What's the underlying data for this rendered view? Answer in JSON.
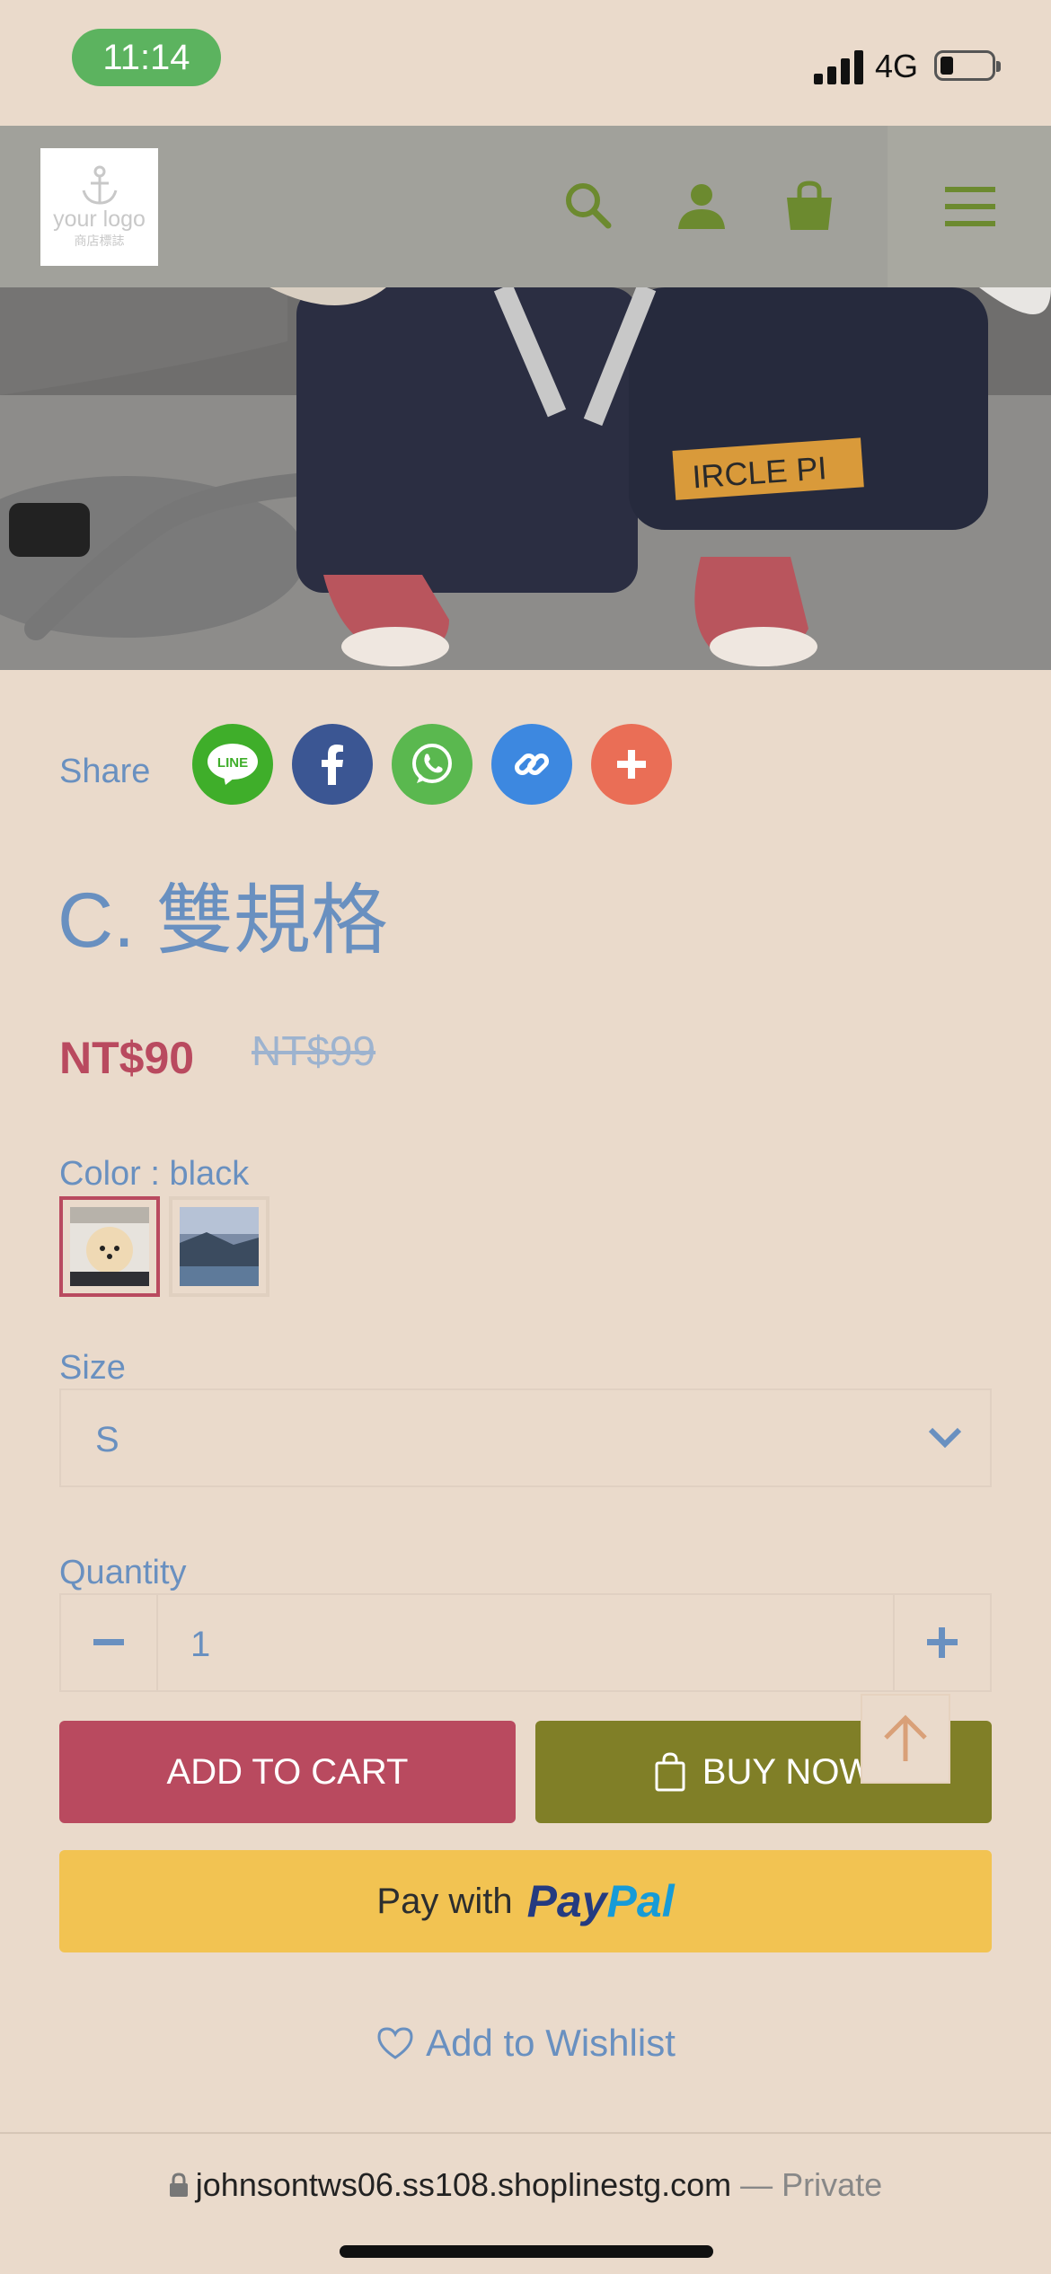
{
  "status_bar": {
    "time": "11:14",
    "network": "4G"
  },
  "header": {
    "logo_text": "your logo",
    "logo_subtext": "商店標誌",
    "icons": [
      "search-icon",
      "user-icon",
      "cart-icon",
      "menu-icon"
    ]
  },
  "share": {
    "label": "Share",
    "buttons": [
      "line",
      "facebook",
      "whatsapp",
      "copy-link",
      "more"
    ]
  },
  "product": {
    "title": "C. 雙規格",
    "price": "NT$90",
    "original_price": "NT$99",
    "color_label": "Color : black",
    "size_label": "Size",
    "size_value": "S",
    "quantity_label": "Quantity",
    "quantity_value": "1"
  },
  "actions": {
    "add_to_cart": "ADD TO CART",
    "buy_now": "BUY NOW",
    "paypal_prefix": "Pay with",
    "paypal_brand_1": "Pay",
    "paypal_brand_2": "Pal",
    "wishlist": "Add to Wishlist"
  },
  "browser": {
    "url": "johnsontws06.ss108.shoplinestg.com",
    "privacy": "— Private"
  },
  "colors": {
    "accent_red": "#b94a5f",
    "accent_olive": "#807f27",
    "text_blue": "#6990c0",
    "background": "#eadacb"
  }
}
